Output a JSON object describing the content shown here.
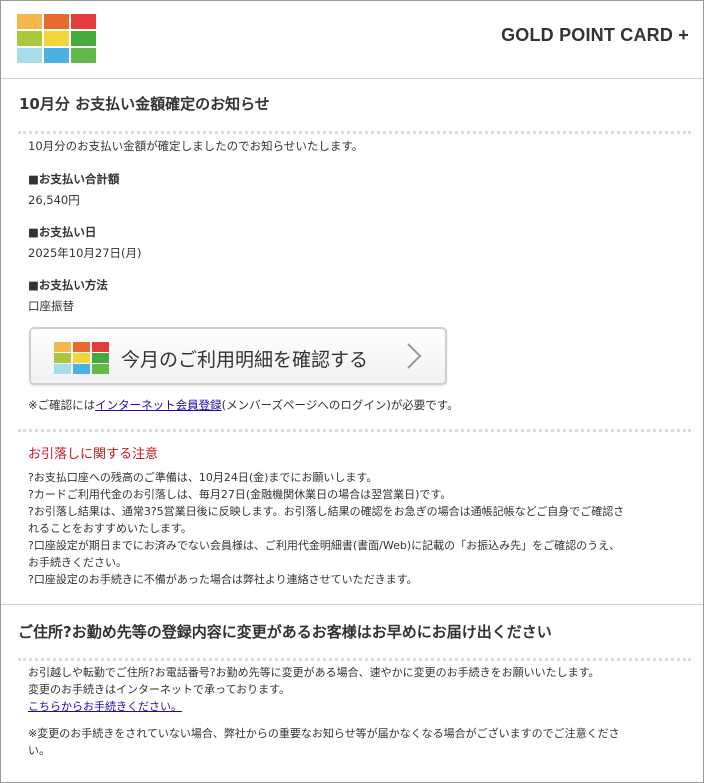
{
  "header": {
    "brand": "GOLD POINT CARD +",
    "logo_colors": [
      "#f6b84b",
      "#e86a2c",
      "#e23c3f",
      "#a9c93a",
      "#f2d53a",
      "#45a93c",
      "#a6dde8",
      "#4bb0e2",
      "#62b949"
    ]
  },
  "notice": {
    "title": "10月分 お支払い金額確定のお知らせ",
    "intro": "10月分のお支払い金額が確定しましたのでお知らせいたします。",
    "total_label": "■お支払い合計額",
    "total_value": "26,540円",
    "date_label": "■お支払い日",
    "date_value": "2025年10月27日(月)",
    "method_label": "■お支払い方法",
    "method_value": "口座振替",
    "cta_label": "今月のご利用明細を確認する",
    "confirm_prefix": "※ご確認には",
    "confirm_link": "インターネット会員登録",
    "confirm_suffix": "(メンバーズページへのログイン)が必要です。"
  },
  "caution": {
    "title": "お引落しに関する注意",
    "lines": [
      "?お支払口座への残高のご準備は、10月24日(金)までにお願いします。",
      "?カードご利用代金のお引落しは、毎月27日(金融機関休業日の場合は翌営業日)です。",
      "?お引落し結果は、通常3?5営業日後に反映します。お引落し結果の確認をお急ぎの場合は通帳記帳などご自身でご確認さ",
      "れることをおすすめいたします。",
      "?口座設定が期日までにお済みでない会員様は、ご利用代金明細書(書面/Web)に記載の「お振込み先」をご確認のうえ、",
      "お手続きください。",
      "?口座設定のお手続きに不備があった場合は弊社より連絡させていただきます。"
    ]
  },
  "address": {
    "title": "ご住所?お勤め先等の登録内容に変更があるお客様はお早めにお届け出ください",
    "line1": "お引越しや転勤でご住所?お電話番号?お勤め先等に変更がある場合、速やかに変更のお手続きをお願いいたします。",
    "line2": "変更のお手続きはインターネットで承っております。",
    "link": "こちらからお手続きください。",
    "note1": "※変更のお手続きをされていない場合、弊社からの重要なお知らせ等が届かなくなる場合がございますのでご注意くださ",
    "note2": "い。"
  }
}
